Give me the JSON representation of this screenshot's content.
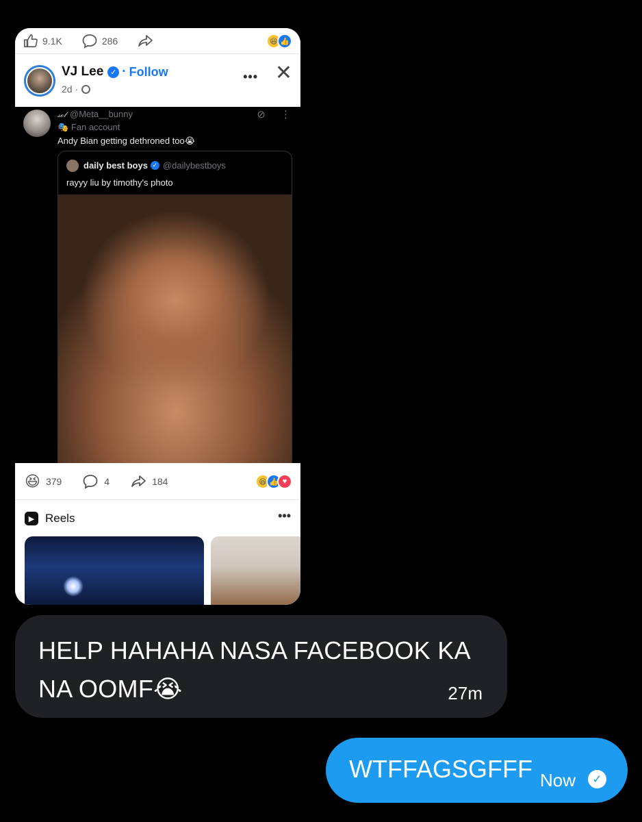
{
  "screenshot": {
    "top_bar": {
      "likes": "9.1K",
      "comments": "286"
    },
    "post_header": {
      "name": "VJ Lee",
      "separator": "·",
      "follow_label": "Follow",
      "age": "2d ·",
      "more_label": "•••",
      "close_label": "✕"
    },
    "tweet": {
      "display_name_glyph": "𝓈ℴ𝓁",
      "handle": "@Meta__bunny",
      "fan_label": "Fan account",
      "text": "Andy Bian getting dethroned too😭",
      "quote": {
        "name": "daily best boys",
        "handle": "@dailybestboys",
        "text": "rayyy liu by timothy's photo"
      }
    },
    "reactions": {
      "count": "379",
      "comments": "4",
      "shares": "184"
    },
    "reels": {
      "title": "Reels",
      "more_label": "•••"
    }
  },
  "messages": [
    {
      "text": "HELP HAHAHA NASA FACEBOOK KA NA OOMF😭",
      "time": "27m"
    },
    {
      "text": "WTFFAGSGFFF",
      "time": "Now"
    }
  ]
}
